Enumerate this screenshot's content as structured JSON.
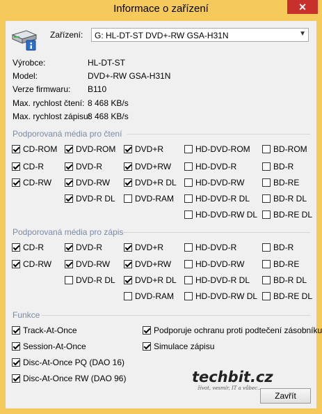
{
  "window": {
    "title": "Informace o zařízení",
    "close_glyph": "✕"
  },
  "device": {
    "label": "Zařízení:",
    "selected": "G: HL-DT-ST DVD+-RW GSA-H31N",
    "icon": "drive-info-icon"
  },
  "info": [
    {
      "label": "Výrobce:",
      "value": "HL-DT-ST"
    },
    {
      "label": "Model:",
      "value": "DVD+-RW GSA-H31N"
    },
    {
      "label": "Verze firmwaru:",
      "value": "B110"
    },
    {
      "label": "Max. rychlost čtení:",
      "value": "8 468 KB/s"
    },
    {
      "label": "Max. rychlost zápisu:",
      "value": "8 468 KB/s"
    }
  ],
  "read_media": {
    "title": "Podporovaná média pro čtení",
    "items": [
      {
        "label": "CD-ROM",
        "checked": true
      },
      {
        "label": "DVD-ROM",
        "checked": true
      },
      {
        "label": "DVD+R",
        "checked": true
      },
      {
        "label": "HD-DVD-ROM",
        "checked": false
      },
      {
        "label": "BD-ROM",
        "checked": false
      },
      {
        "label": "CD-R",
        "checked": true
      },
      {
        "label": "DVD-R",
        "checked": true
      },
      {
        "label": "DVD+RW",
        "checked": true
      },
      {
        "label": "HD-DVD-R",
        "checked": false
      },
      {
        "label": "BD-R",
        "checked": false
      },
      {
        "label": "CD-RW",
        "checked": true
      },
      {
        "label": "DVD-RW",
        "checked": true
      },
      {
        "label": "DVD+R DL",
        "checked": true
      },
      {
        "label": "HD-DVD-RW",
        "checked": false
      },
      {
        "label": "BD-RE",
        "checked": false
      },
      {
        "label": "DVD-R DL",
        "checked": true
      },
      {
        "label": "DVD-RAM",
        "checked": false
      },
      {
        "label": "HD-DVD-R DL",
        "checked": false
      },
      {
        "label": "BD-R DL",
        "checked": false
      },
      {
        "label": "HD-DVD-RW DL",
        "checked": false
      },
      {
        "label": "BD-RE DL",
        "checked": false
      }
    ]
  },
  "write_media": {
    "title": "Podporovaná média pro zápis",
    "items": [
      {
        "label": "CD-R",
        "checked": true
      },
      {
        "label": "DVD-R",
        "checked": true
      },
      {
        "label": "DVD+R",
        "checked": true
      },
      {
        "label": "HD-DVD-R",
        "checked": false
      },
      {
        "label": "BD-R",
        "checked": false
      },
      {
        "label": "CD-RW",
        "checked": true
      },
      {
        "label": "DVD-RW",
        "checked": true
      },
      {
        "label": "DVD+RW",
        "checked": true
      },
      {
        "label": "HD-DVD-RW",
        "checked": false
      },
      {
        "label": "BD-RE",
        "checked": false
      },
      {
        "label": "DVD-R DL",
        "checked": false
      },
      {
        "label": "DVD+R DL",
        "checked": true
      },
      {
        "label": "HD-DVD-R DL",
        "checked": false
      },
      {
        "label": "BD-R DL",
        "checked": false
      },
      {
        "label": "DVD-RAM",
        "checked": false
      },
      {
        "label": "HD-DVD-RW DL",
        "checked": false
      },
      {
        "label": "BD-RE DL",
        "checked": false
      }
    ]
  },
  "functions": {
    "title": "Funkce",
    "items": [
      {
        "label": "Track-At-Once",
        "checked": true
      },
      {
        "label": "Podporuje ochranu proti podtečení zásobníku",
        "checked": true
      },
      {
        "label": "Session-At-Once",
        "checked": true
      },
      {
        "label": "Simulace zápisu",
        "checked": true
      },
      {
        "label": "Disc-At-Once PQ (DAO 16)",
        "checked": true
      },
      {
        "label": "Disc-At-Once RW (DAO 96)",
        "checked": true
      }
    ]
  },
  "logo": {
    "main": "techbit.cz",
    "sub": "život, vesmír, IT a vůbec..."
  },
  "buttons": {
    "close": "Zavřít"
  }
}
